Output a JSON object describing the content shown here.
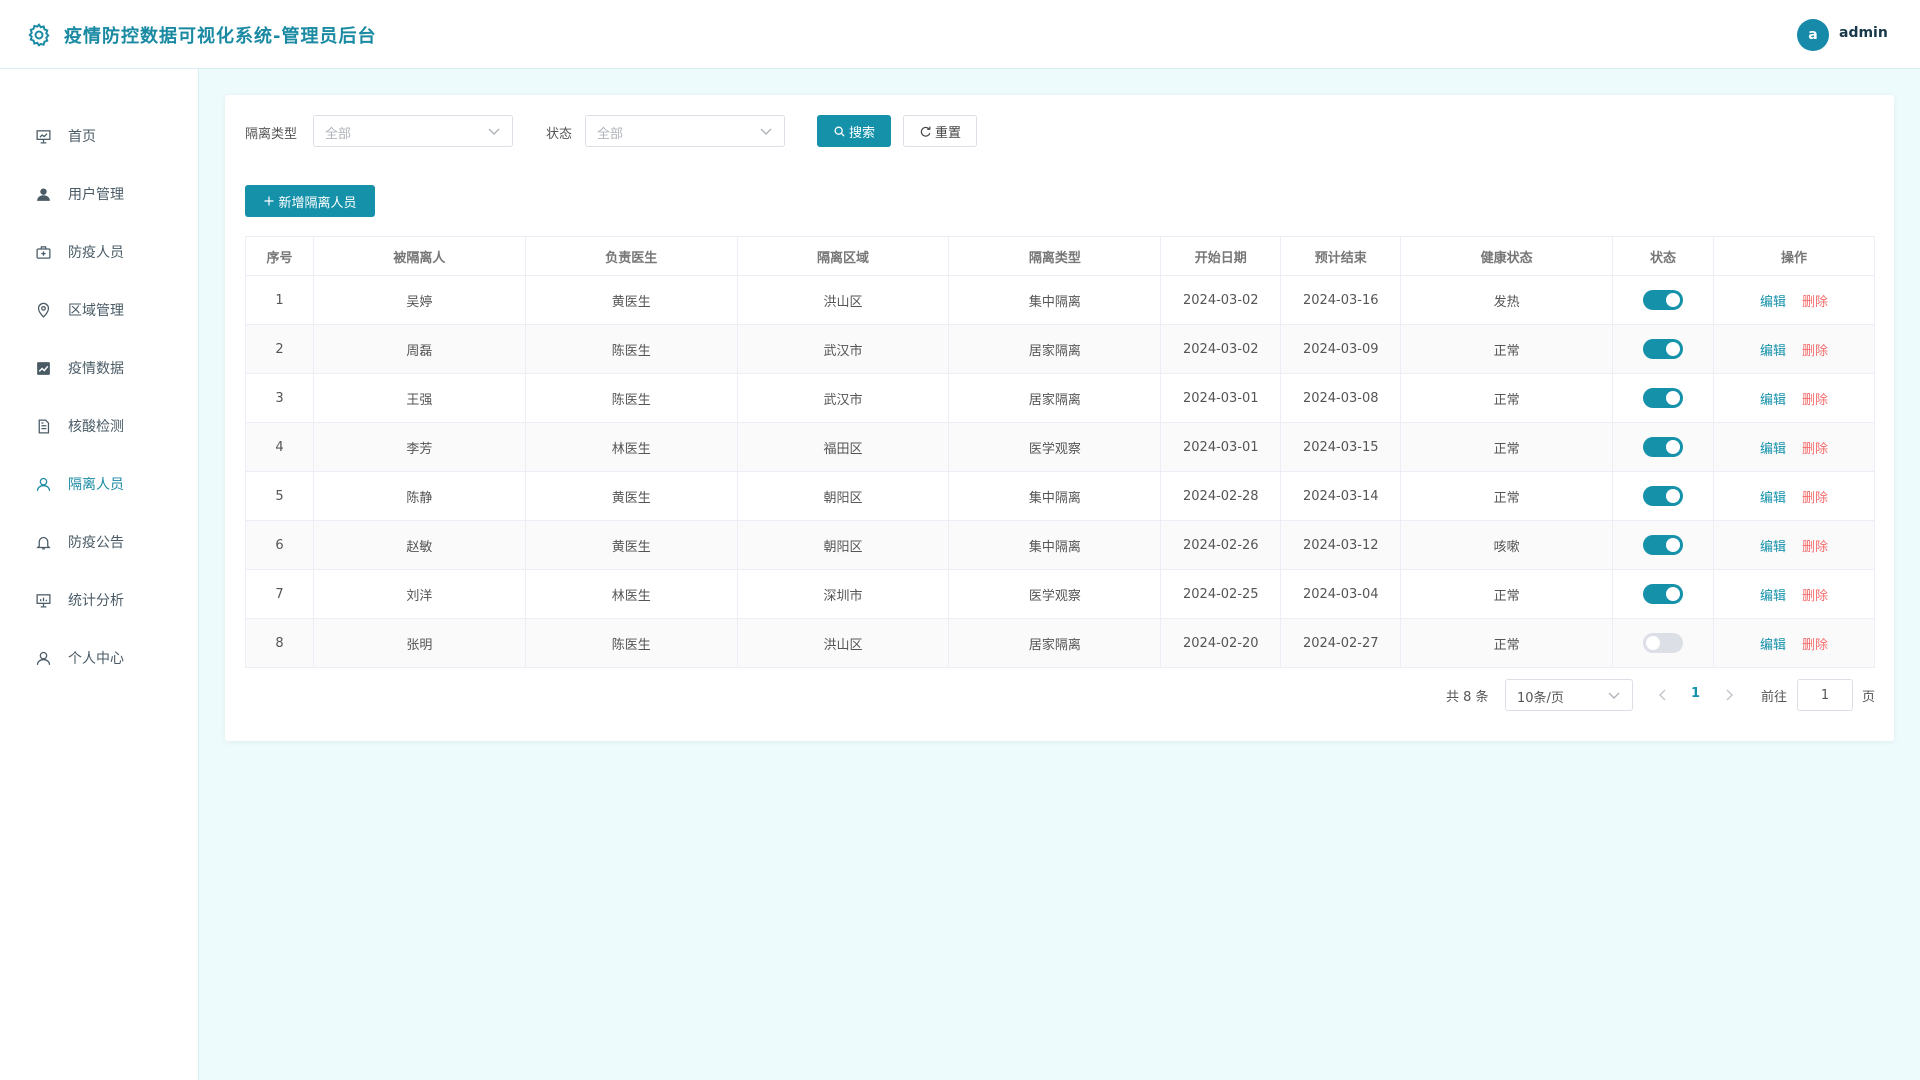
{
  "header": {
    "title": "疫情防控数据可视化系统-管理员后台",
    "avatar_letter": "a",
    "user_name": "admin"
  },
  "sidebar": {
    "items": [
      {
        "label": "首页",
        "icon": "presentation-icon"
      },
      {
        "label": "用户管理",
        "icon": "user-icon"
      },
      {
        "label": "防疫人员",
        "icon": "medical-box-icon"
      },
      {
        "label": "区域管理",
        "icon": "location-icon"
      },
      {
        "label": "疫情数据",
        "icon": "chart-icon"
      },
      {
        "label": "核酸检测",
        "icon": "document-icon"
      },
      {
        "label": "隔离人员",
        "icon": "user-outline-icon",
        "active": true
      },
      {
        "label": "防疫公告",
        "icon": "bell-icon"
      },
      {
        "label": "统计分析",
        "icon": "stats-board-icon"
      },
      {
        "label": "个人中心",
        "icon": "person-icon"
      }
    ]
  },
  "filters": {
    "type_label": "隔离类型",
    "type_value": "全部",
    "status_label": "状态",
    "status_value": "全部",
    "search_label": "搜索",
    "reset_label": "重置"
  },
  "add_button_label": "新增隔离人员",
  "table": {
    "headers": [
      "序号",
      "被隔离人",
      "负责医生",
      "隔离区域",
      "隔离类型",
      "开始日期",
      "预计结束",
      "健康状态",
      "状态",
      "操作"
    ],
    "rows": [
      {
        "no": "1",
        "name": "吴婷",
        "doctor": "黄医生",
        "area": "洪山区",
        "type": "集中隔离",
        "start": "2024-03-02",
        "end": "2024-03-16",
        "health": "发热",
        "enabled": true
      },
      {
        "no": "2",
        "name": "周磊",
        "doctor": "陈医生",
        "area": "武汉市",
        "type": "居家隔离",
        "start": "2024-03-02",
        "end": "2024-03-09",
        "health": "正常",
        "enabled": true
      },
      {
        "no": "3",
        "name": "王强",
        "doctor": "陈医生",
        "area": "武汉市",
        "type": "居家隔离",
        "start": "2024-03-01",
        "end": "2024-03-08",
        "health": "正常",
        "enabled": true
      },
      {
        "no": "4",
        "name": "李芳",
        "doctor": "林医生",
        "area": "福田区",
        "type": "医学观察",
        "start": "2024-03-01",
        "end": "2024-03-15",
        "health": "正常",
        "enabled": true
      },
      {
        "no": "5",
        "name": "陈静",
        "doctor": "黄医生",
        "area": "朝阳区",
        "type": "集中隔离",
        "start": "2024-02-28",
        "end": "2024-03-14",
        "health": "正常",
        "enabled": true
      },
      {
        "no": "6",
        "name": "赵敏",
        "doctor": "黄医生",
        "area": "朝阳区",
        "type": "集中隔离",
        "start": "2024-02-26",
        "end": "2024-03-12",
        "health": "咳嗽",
        "enabled": true
      },
      {
        "no": "7",
        "name": "刘洋",
        "doctor": "林医生",
        "area": "深圳市",
        "type": "医学观察",
        "start": "2024-02-25",
        "end": "2024-03-04",
        "health": "正常",
        "enabled": true
      },
      {
        "no": "8",
        "name": "张明",
        "doctor": "陈医生",
        "area": "洪山区",
        "type": "居家隔离",
        "start": "2024-02-20",
        "end": "2024-02-27",
        "health": "正常",
        "enabled": false
      }
    ],
    "edit_label": "编辑",
    "delete_label": "删除"
  },
  "pagination": {
    "total_text": "共 8 条",
    "page_size": "10条/页",
    "current_page": "1",
    "goto_label": "前往",
    "goto_value": "1",
    "page_suffix": "页"
  },
  "colors": {
    "primary": "#1591aa",
    "danger": "#f56c6c",
    "background": "#edfbfd"
  }
}
